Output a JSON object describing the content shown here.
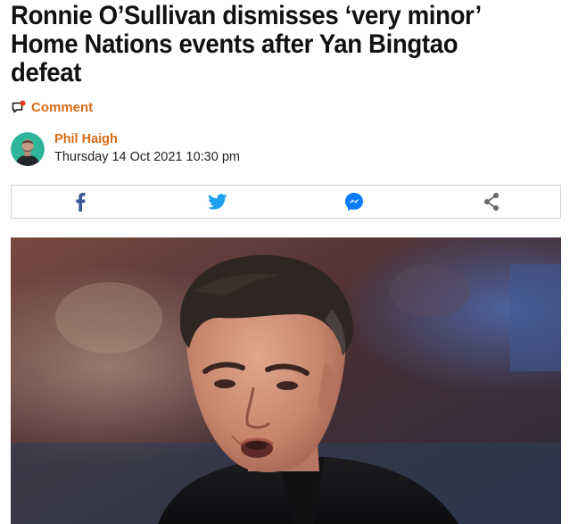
{
  "article": {
    "headline": "Ronnie O’Sullivan dismisses ‘very minor’ Home Nations events after Yan Bingtao defeat",
    "comment_label": "Comment",
    "author": "Phil Haigh",
    "date": "Thursday 14 Oct 2021 10:30 pm"
  },
  "colors": {
    "accent": "#d86a15",
    "headline": "#111111",
    "facebook": "#3b5998",
    "twitter": "#1da1f2",
    "messenger": "#0a7cff",
    "share": "#666666"
  },
  "share_buttons": [
    {
      "id": "facebook",
      "icon": "facebook-icon"
    },
    {
      "id": "twitter",
      "icon": "twitter-icon"
    },
    {
      "id": "messenger",
      "icon": "messenger-icon"
    },
    {
      "id": "share",
      "icon": "share-icon"
    }
  ],
  "hero_image": {
    "subject": "photo-of-snooker-player"
  }
}
